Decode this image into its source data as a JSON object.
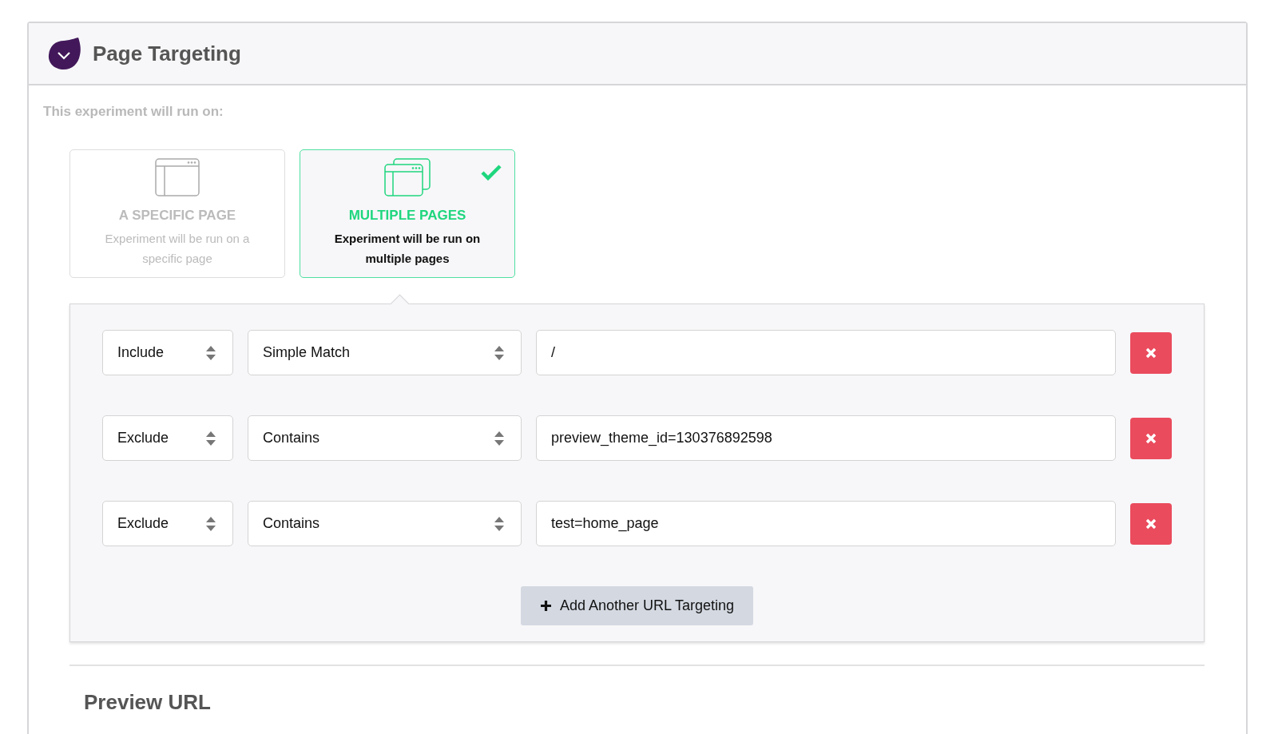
{
  "header": {
    "title": "Page Targeting"
  },
  "intro": "This experiment will run on:",
  "options": [
    {
      "kind": "single",
      "title": "A SPECIFIC PAGE",
      "description": "Experiment will be run on a specific page",
      "selected": false
    },
    {
      "kind": "multiple",
      "title": "MULTIPLE PAGES",
      "description": "Experiment will be run on multiple pages",
      "selected": true
    }
  ],
  "rules": [
    {
      "mode": "Include",
      "match": "Simple Match",
      "value": "/"
    },
    {
      "mode": "Exclude",
      "match": "Contains",
      "value": "preview_theme_id=130376892598"
    },
    {
      "mode": "Exclude",
      "match": "Contains",
      "value": "test=home_page"
    }
  ],
  "add_button": "Add Another URL Targeting",
  "preview_title": "Preview URL"
}
